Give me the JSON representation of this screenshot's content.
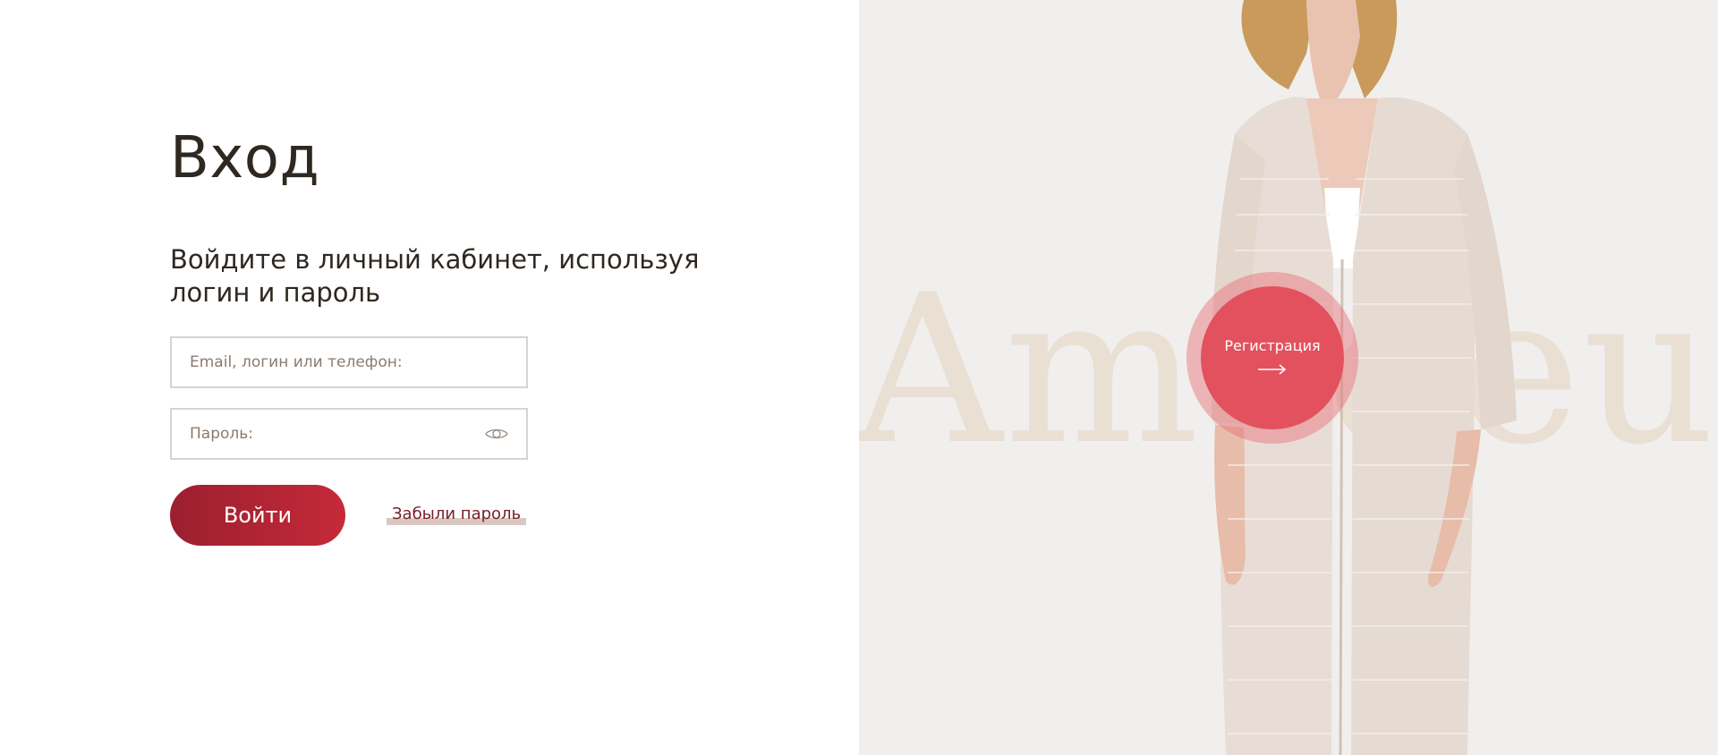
{
  "login": {
    "title": "Вход",
    "subtitle": "Войдите в личный кабинет, используя логин и пароль",
    "login_placeholder": "Email, логин или телефон:",
    "password_placeholder": "Пароль:",
    "submit_label": "Войти",
    "forgot_label": "Забыли пароль"
  },
  "promo": {
    "brand_watermark": "Amadeus",
    "register_label": "Регистрация",
    "model_image_alt": "Model wearing open-knit cream long cardigan"
  },
  "icons": {
    "password_toggle": "eye-icon",
    "register_arrow": "arrow-right-icon"
  },
  "colors": {
    "accent_red": "#c52a38",
    "accent_dark_red": "#9b1f2f",
    "register_circle": "#e3515e",
    "title_text": "#2e2820",
    "link_text": "#7a1c26",
    "promo_background": "#f0efed",
    "watermark_color": "#e9dfd3"
  }
}
